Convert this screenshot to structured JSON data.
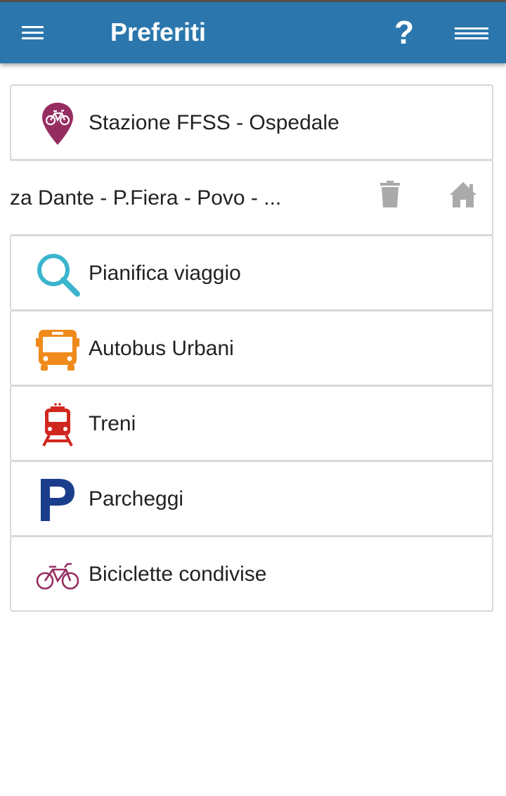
{
  "app_bar": {
    "title": "Preferiti",
    "help_label": "?",
    "background_color": "#2b77ad"
  },
  "favorites": [
    {
      "label": "Stazione FFSS - Ospedale",
      "icon": "bike-station-pin-icon",
      "color": "#962d61"
    },
    {
      "label": "za Dante - P.Fiera - Povo - ...",
      "icon": null,
      "actions": [
        "trash-icon",
        "home-icon"
      ],
      "swiped": true
    },
    {
      "label": "Pianifica viaggio",
      "icon": "search-icon",
      "color": "#3ab5cc"
    },
    {
      "label": "Autobus Urbani",
      "icon": "bus-icon",
      "color": "#ef8a1b"
    },
    {
      "label": "Treni",
      "icon": "train-icon",
      "color": "#d0271f"
    },
    {
      "label": "Parcheggi",
      "icon": "parking-icon",
      "color": "#1b3e8c"
    },
    {
      "label": "Biciclette condivise",
      "icon": "bicycle-icon",
      "color": "#962d61"
    }
  ]
}
